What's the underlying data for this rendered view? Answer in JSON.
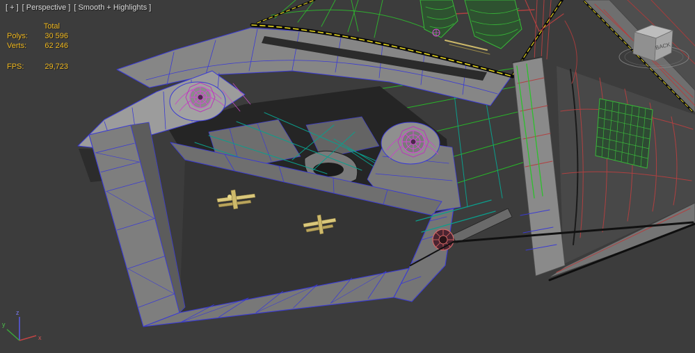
{
  "viewport": {
    "menus": {
      "general": "[ + ]",
      "pov": "[ Perspective ]",
      "shading": "[ Smooth + Highlights ]"
    }
  },
  "stats": {
    "total_label": "Total",
    "rows": [
      {
        "label": "Polys:",
        "value": "30 596"
      },
      {
        "label": "Verts:",
        "value": "62 246"
      }
    ],
    "fps_label": "FPS:",
    "fps_value": "29,723"
  },
  "viewcube": {
    "visible_face": "BACK"
  },
  "axis_tripod": {
    "x_label": "x",
    "y_label": "y",
    "z_label": "z"
  },
  "scene": {
    "description": "Wireframe 3D car body shell (front clip, engine bay and cabin) shown in perspective, smooth+highlights shading with edged faces",
    "colors": {
      "background": "#3c3c3c",
      "surface_grey": "#8a8a8a",
      "wire_blue": "#3a3ad4",
      "wire_magenta": "#d44ad4",
      "wire_teal": "#0b9e8c",
      "wire_green": "#2cc02c",
      "wire_red": "#b04040",
      "selected_edge_yellow": "#e8d820",
      "part_tan": "#cdb96a",
      "stats_text": "#f0b81e"
    }
  }
}
